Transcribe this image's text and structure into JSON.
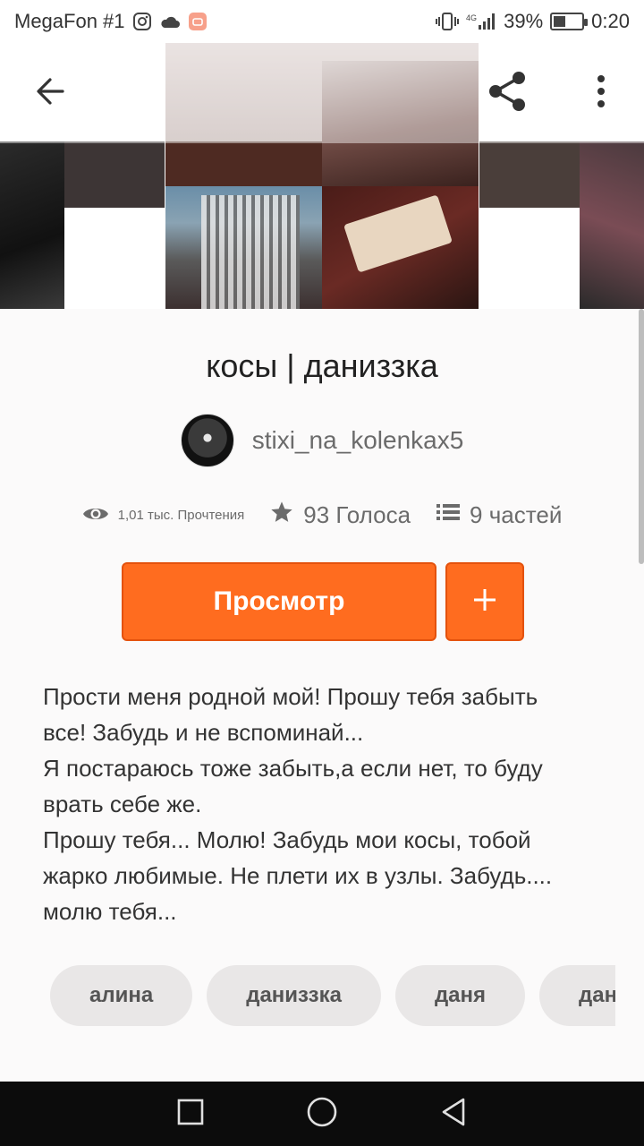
{
  "status_bar": {
    "carrier": "MegaFon #1",
    "network": "4G",
    "battery_percent": "39%",
    "battery_level": 0.39,
    "time": "0:20"
  },
  "header": {
    "icons": [
      "arrow-back-icon",
      "share-icon",
      "more-vert-icon"
    ]
  },
  "story": {
    "title": "косы | даниззка",
    "author": "stixi_na_kolenkax5",
    "reads": "1,01 тыс. Прочтения",
    "votes": "93 Голоса",
    "parts": "9 частей"
  },
  "actions": {
    "read_label": "Просмотр",
    "add_label": "+"
  },
  "description": [
    "Прости меня родной мой! Прошу тебя забыть",
    "все! Забудь и не вспоминай...",
    "Я постараюсь тоже забыть,а если нет, то буду",
    "врать себе же.",
    "Прошу тебя... Молю! Забудь мои косы, тобой",
    "жарко любимые. Не плети их в узлы. Забудь....",
    "молю тебя..."
  ],
  "tags": [
    "алина",
    "даниззка",
    "даня",
    "даня"
  ],
  "colors": {
    "accent": "#ff6c1f",
    "tag_bg": "#e9e7e7",
    "nav_bg": "#0c0c0c"
  }
}
